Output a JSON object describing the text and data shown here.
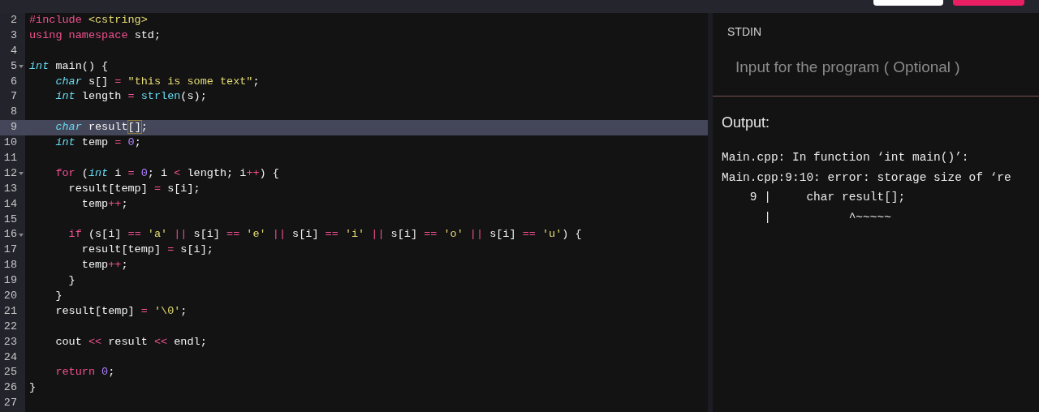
{
  "top_bar": {
    "buttons": [
      {
        "kind": "secondary"
      },
      {
        "kind": "primary"
      }
    ]
  },
  "editor": {
    "lines": [
      {
        "number": "2",
        "selected": false,
        "foldable": false,
        "tokens": [
          {
            "kind": "keyword",
            "text": "#include"
          },
          {
            "kind": "string",
            "text": " <cstring>"
          }
        ]
      },
      {
        "number": "3",
        "selected": false,
        "foldable": false,
        "tokens": [
          {
            "kind": "keyword",
            "text": "using namespace"
          },
          {
            "kind": "plain",
            "text": " std;"
          }
        ]
      },
      {
        "number": "4",
        "selected": false,
        "foldable": false
      },
      {
        "number": "5",
        "selected": false,
        "foldable": true,
        "tokens": [
          {
            "kind": "type",
            "text": "int"
          },
          {
            "kind": "plain",
            "text": " main() {"
          }
        ]
      },
      {
        "number": "6",
        "selected": false,
        "foldable": false,
        "tokens": [
          {
            "kind": "type",
            "text": "    char"
          },
          {
            "kind": "plain",
            "text": " s[] "
          },
          {
            "kind": "operator",
            "text": "="
          },
          {
            "kind": "string",
            "text": " \"this is some text\""
          },
          {
            "kind": "plain",
            "text": ";"
          }
        ]
      },
      {
        "number": "7",
        "selected": false,
        "foldable": false,
        "tokens": [
          {
            "kind": "type",
            "text": "    int"
          },
          {
            "kind": "plain",
            "text": " length "
          },
          {
            "kind": "operator",
            "text": "="
          },
          {
            "kind": "function",
            "text": " strlen"
          },
          {
            "kind": "plain",
            "text": "(s);"
          }
        ]
      },
      {
        "number": "8",
        "selected": false,
        "foldable": false
      },
      {
        "number": "9",
        "selected": true,
        "foldable": false,
        "tokens": [
          {
            "kind": "type",
            "text": "    char"
          },
          {
            "kind": "plain",
            "text": " result"
          },
          {
            "kind": "bracket_match",
            "text": "[]"
          },
          {
            "kind": "plain",
            "text": ";"
          }
        ]
      },
      {
        "number": "10",
        "selected": false,
        "foldable": false,
        "tokens": [
          {
            "kind": "type",
            "text": "    int"
          },
          {
            "kind": "plain",
            "text": " temp "
          },
          {
            "kind": "operator",
            "text": "="
          },
          {
            "kind": "number",
            "text": " 0"
          },
          {
            "kind": "plain",
            "text": ";"
          }
        ]
      },
      {
        "number": "11",
        "selected": false,
        "foldable": false
      },
      {
        "number": "12",
        "selected": false,
        "foldable": true,
        "tokens": [
          {
            "kind": "keyword",
            "text": "    for"
          },
          {
            "kind": "plain",
            "text": " ("
          },
          {
            "kind": "type",
            "text": "int"
          },
          {
            "kind": "plain",
            "text": " i "
          },
          {
            "kind": "operator",
            "text": "="
          },
          {
            "kind": "number",
            "text": " 0"
          },
          {
            "kind": "plain",
            "text": "; i "
          },
          {
            "kind": "operator",
            "text": "<"
          },
          {
            "kind": "plain",
            "text": " length; i"
          },
          {
            "kind": "operator",
            "text": "++"
          },
          {
            "kind": "plain",
            "text": ") {"
          }
        ]
      },
      {
        "number": "13",
        "selected": false,
        "foldable": false,
        "tokens": [
          {
            "kind": "plain",
            "text": "      result[temp] "
          },
          {
            "kind": "operator",
            "text": "="
          },
          {
            "kind": "plain",
            "text": " s[i];"
          }
        ]
      },
      {
        "number": "14",
        "selected": false,
        "foldable": false,
        "tokens": [
          {
            "kind": "plain",
            "text": "        temp"
          },
          {
            "kind": "operator",
            "text": "++"
          },
          {
            "kind": "plain",
            "text": ";"
          }
        ]
      },
      {
        "number": "15",
        "selected": false,
        "foldable": false
      },
      {
        "number": "16",
        "selected": false,
        "foldable": true,
        "tokens": [
          {
            "kind": "keyword",
            "text": "      if"
          },
          {
            "kind": "plain",
            "text": " (s[i] "
          },
          {
            "kind": "operator",
            "text": "=="
          },
          {
            "kind": "string",
            "text": " 'a' "
          },
          {
            "kind": "operator",
            "text": "||"
          },
          {
            "kind": "plain",
            "text": " s[i] "
          },
          {
            "kind": "operator",
            "text": "=="
          },
          {
            "kind": "string",
            "text": " 'e' "
          },
          {
            "kind": "operator",
            "text": "||"
          },
          {
            "kind": "plain",
            "text": " s[i] "
          },
          {
            "kind": "operator",
            "text": "=="
          },
          {
            "kind": "string",
            "text": " 'i' "
          },
          {
            "kind": "operator",
            "text": "||"
          },
          {
            "kind": "plain",
            "text": " s[i] "
          },
          {
            "kind": "operator",
            "text": "=="
          },
          {
            "kind": "string",
            "text": " 'o' "
          },
          {
            "kind": "operator",
            "text": "||"
          },
          {
            "kind": "plain",
            "text": " s[i] "
          },
          {
            "kind": "operator",
            "text": "=="
          },
          {
            "kind": "string",
            "text": " 'u'"
          },
          {
            "kind": "plain",
            "text": ") {"
          }
        ]
      },
      {
        "number": "17",
        "selected": false,
        "foldable": false,
        "tokens": [
          {
            "kind": "plain",
            "text": "        result[temp] "
          },
          {
            "kind": "operator",
            "text": "="
          },
          {
            "kind": "plain",
            "text": " s[i];"
          }
        ]
      },
      {
        "number": "18",
        "selected": false,
        "foldable": false,
        "tokens": [
          {
            "kind": "plain",
            "text": "        temp"
          },
          {
            "kind": "operator",
            "text": "++"
          },
          {
            "kind": "plain",
            "text": ";"
          }
        ]
      },
      {
        "number": "19",
        "selected": false,
        "foldable": false,
        "tokens": [
          {
            "kind": "plain",
            "text": "      }"
          }
        ]
      },
      {
        "number": "20",
        "selected": false,
        "foldable": false,
        "tokens": [
          {
            "kind": "plain",
            "text": "    }"
          }
        ]
      },
      {
        "number": "21",
        "selected": false,
        "foldable": false,
        "tokens": [
          {
            "kind": "plain",
            "text": "    result[temp] "
          },
          {
            "kind": "operator",
            "text": "="
          },
          {
            "kind": "string",
            "text": " '\\0'"
          },
          {
            "kind": "plain",
            "text": ";"
          }
        ]
      },
      {
        "number": "22",
        "selected": false,
        "foldable": false
      },
      {
        "number": "23",
        "selected": false,
        "foldable": false,
        "tokens": [
          {
            "kind": "plain",
            "text": "    cout "
          },
          {
            "kind": "operator",
            "text": "<<"
          },
          {
            "kind": "plain",
            "text": " result "
          },
          {
            "kind": "operator",
            "text": "<<"
          },
          {
            "kind": "plain",
            "text": " endl;"
          }
        ]
      },
      {
        "number": "24",
        "selected": false,
        "foldable": false
      },
      {
        "number": "25",
        "selected": false,
        "foldable": false,
        "tokens": [
          {
            "kind": "keyword",
            "text": "    return"
          },
          {
            "kind": "number",
            "text": " 0"
          },
          {
            "kind": "plain",
            "text": ";"
          }
        ]
      },
      {
        "number": "26",
        "selected": false,
        "foldable": false,
        "tokens": [
          {
            "kind": "plain",
            "text": "}"
          }
        ]
      },
      {
        "number": "27",
        "selected": false,
        "foldable": false
      }
    ]
  },
  "stdin": {
    "label": "STDIN",
    "placeholder": "Input for the program ( Optional )"
  },
  "output": {
    "label": "Output:",
    "lines": [
      "Main.cpp: In function ‘int main()’:",
      "Main.cpp:9:10: error: storage size of ‘re",
      "    9 |     char result[];",
      "      |           ^~~~~~"
    ]
  }
}
